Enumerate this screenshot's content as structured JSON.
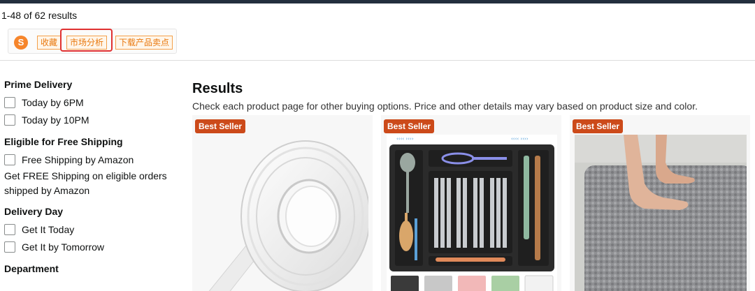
{
  "results_count": "1-48 of 62 results",
  "plugin_bar": {
    "logo_letter": "S",
    "buttons": [
      "收藏",
      "市场分析",
      "下载产品卖点"
    ]
  },
  "sidebar": {
    "sections": [
      {
        "heading": "Prime Delivery",
        "options": [
          "Today by 6PM",
          "Today by 10PM"
        ]
      },
      {
        "heading": "Eligible for Free Shipping",
        "options": [
          "Free Shipping by Amazon"
        ],
        "note": "Get FREE Shipping on eligible orders shipped by Amazon"
      },
      {
        "heading": "Delivery Day",
        "options": [
          "Get It Today",
          "Get It by Tomorrow"
        ]
      },
      {
        "heading": "Department",
        "options": []
      }
    ]
  },
  "main": {
    "title": "Results",
    "subtitle": "Check each product page for other buying options. Price and other details may vary based on product size and color."
  },
  "products": [
    {
      "badge": "Best Seller",
      "image": "clear-double-sided-tape-roll"
    },
    {
      "badge": "Best Seller",
      "image": "expandable-drawer-organizer-with-utensils"
    },
    {
      "badge": "Best Seller",
      "image": "gray-chenille-bath-mat"
    }
  ],
  "colors": {
    "badge": "#cc4a1a",
    "plugin_accent": "#f4a04a",
    "highlight": "#e03131"
  }
}
